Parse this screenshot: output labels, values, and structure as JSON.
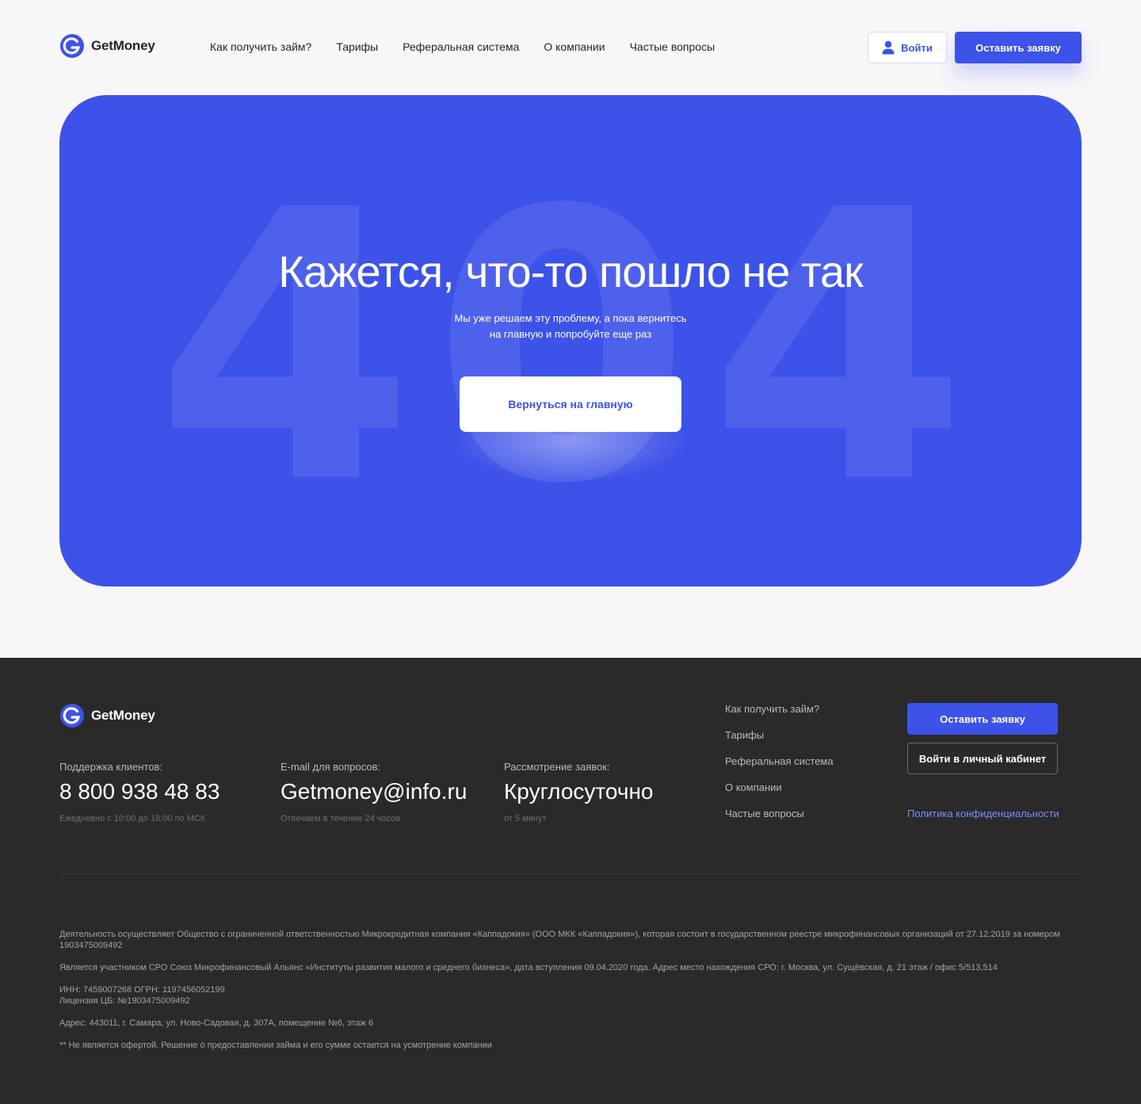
{
  "brand": {
    "name": "GetMoney",
    "accent": "#3d52e8",
    "dark": "#2a2a2a",
    "link": "#7c8cff"
  },
  "header": {
    "nav": [
      "Как получить займ?",
      "Тарифы",
      "Реферальная система",
      "О компании",
      "Частые вопросы"
    ],
    "login_label": "Войти",
    "apply_label": "Оставить заявку"
  },
  "hero": {
    "bg_code": "404",
    "title": "Кажется, что-то пошло не так",
    "subtitle_line1": "Мы уже решаем эту проблему, а пока вернитесь",
    "subtitle_line2": "на главную и попробуйте еще раз",
    "home_button": "Вернуться на главную"
  },
  "footer": {
    "support": {
      "label": "Поддержка клиентов:",
      "value": "8 800 938 48 83",
      "note": "Ежедневно с 10:00 до 18:00 по МСК"
    },
    "email": {
      "label": "E-mail для вопросов:",
      "value": "Getmoney@info.ru",
      "note": "Отвечаем в течение 24 часов"
    },
    "review": {
      "label": "Рассмотрение заявок:",
      "value": "Круглосуточно",
      "note": "от 5 минут"
    },
    "nav": [
      "Как получить займ?",
      "Тарифы",
      "Реферальная система",
      "О компании",
      "Частые вопросы"
    ],
    "apply_label": "Оставить заявку",
    "cabinet_label": "Войти в личный кабинет",
    "privacy_label": "Политика конфиденциальности",
    "legal": [
      "Деятельность осуществляет Общество с ограниченной ответственностью Микрокредитная компания «Каппадокия» (ООО МКК «Каппадокия»), которая состоит в государственном реестре микрофинансовых организаций от 27.12.2019 за номером 1903475009492",
      "Является участником СРО Союз Микрофинансовый Альянс «Институты развития малого и среднего бизнеса», дата вступления 09.04.2020 года. Адрес место нахождения СРО: г. Москва, ул. Сущёвская, д. 21 этаж / офис 5/513,514",
      "ИНН: 7459007268 ОГРН: 1197456052199",
      "Лицензия ЦБ: №1903475009492",
      "Адрес: 443011, г. Самара, ул. Ново-Садовая, д. 307А, помещение №6, этаж 6",
      "** Не является офертой. Решение о предоставлении займа и его сумме остается на усмотрение компании"
    ]
  }
}
